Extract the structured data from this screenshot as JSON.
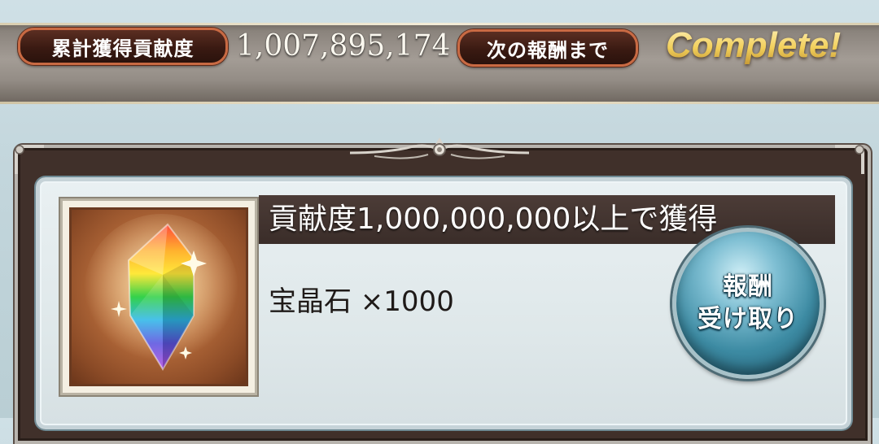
{
  "status": {
    "total_label": "累計獲得貢献度",
    "total_value": "1,007,895,174",
    "next_label": "次の報酬まで",
    "next_value": "Complete!"
  },
  "reward": {
    "title": "貢献度1,000,000,000以上で獲得",
    "item": "宝晶石 ×1000",
    "claim_line1": "報酬",
    "claim_line2": "受け取り",
    "icon": "crystal-icon"
  },
  "colors": {
    "pill_border": "#c96a43",
    "complete_gold": "#f2cf5a",
    "button_blue": "#3d8ba3",
    "title_bar": "#3a2d29"
  }
}
